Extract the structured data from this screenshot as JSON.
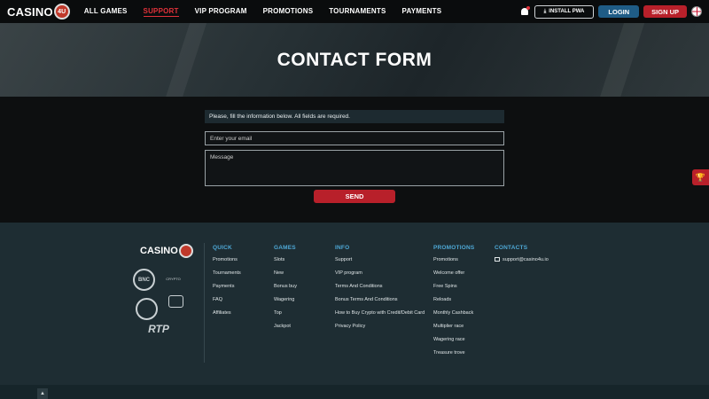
{
  "header": {
    "logo_text": "CASINO",
    "logo_chip": "4U",
    "nav": [
      "ALL GAMES",
      "SUPPORT",
      "VIP PROGRAM",
      "PROMOTIONS",
      "TOURNAMENTS",
      "PAYMENTS"
    ],
    "active_nav": "SUPPORT",
    "install_label": "INSTALL PWA",
    "login_label": "LOGIN",
    "signup_label": "SIGN UP"
  },
  "banner": {
    "title": "CONTACT FORM"
  },
  "form": {
    "note": "Please, fill the information below. All fields are required.",
    "email_placeholder": "Enter your email",
    "message_placeholder": "Message",
    "send_label": "SEND"
  },
  "footer": {
    "logo_text": "CASINO",
    "partners": [
      "BNC",
      "CRYPTO",
      "RTP"
    ],
    "quick": {
      "title": "QUICK",
      "items": [
        "Promotions",
        "Tournaments",
        "Payments",
        "FAQ",
        "Affiliates"
      ]
    },
    "games": {
      "title": "GAMES",
      "items": [
        "Slots",
        "New",
        "Bonus buy",
        "Wagering",
        "Top",
        "Jackpot"
      ]
    },
    "info": {
      "title": "INFO",
      "items": [
        "Support",
        "VIP program",
        "Terms And Conditions",
        "Bonus Terms And Conditions",
        "How to Buy Crypto with Credit/Debit Card",
        "Privacy Policy"
      ]
    },
    "promotions": {
      "title": "PROMOTIONS",
      "items": [
        "Promotions",
        "Welcome offer",
        "Free Spins",
        "Reloads",
        "Monthly Cashback",
        "Multiplier race",
        "Wagering race",
        "Treasure trove"
      ]
    },
    "contacts": {
      "title": "CONTACTS",
      "email": "support@casino4u.io"
    }
  },
  "colors": {
    "accent_red": "#b8202a",
    "accent_blue": "#4ea8d6",
    "login_blue": "#1f5c86"
  }
}
